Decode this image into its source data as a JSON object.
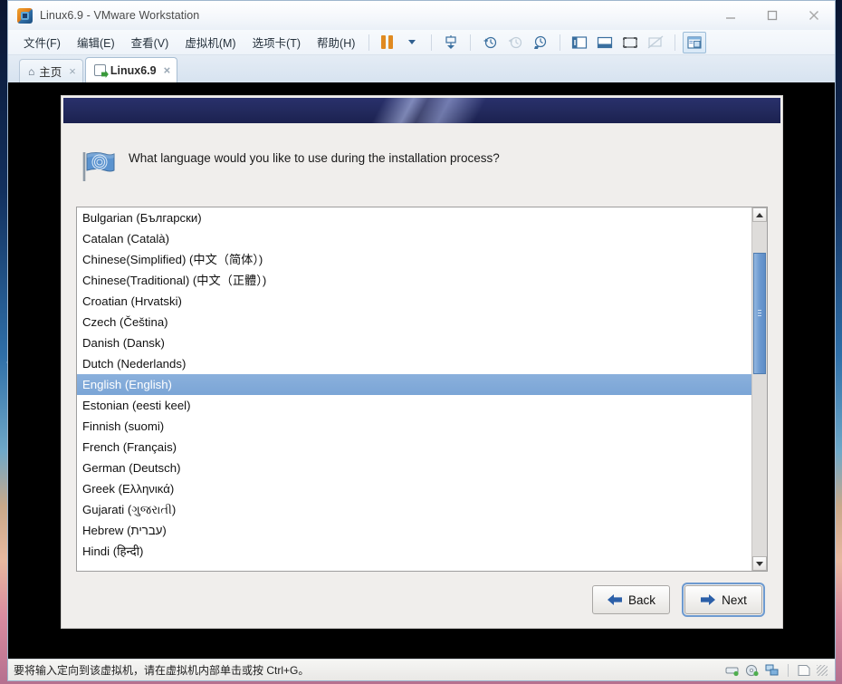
{
  "window": {
    "title": "Linux6.9 - VMware Workstation",
    "app_icon": "vmware-icon",
    "minimize_label": "Minimize",
    "maximize_label": "Maximize",
    "close_label": "Close"
  },
  "menubar": {
    "items": [
      {
        "label": "文件(F)",
        "name": "menu-file"
      },
      {
        "label": "编辑(E)",
        "name": "menu-edit"
      },
      {
        "label": "查看(V)",
        "name": "menu-view"
      },
      {
        "label": "虚拟机(M)",
        "name": "menu-vm"
      },
      {
        "label": "选项卡(T)",
        "name": "menu-tabs"
      },
      {
        "label": "帮助(H)",
        "name": "menu-help"
      }
    ],
    "toolbar_icons": [
      "suspend-icon",
      "dropdown-caret-icon",
      "power-icon",
      "snapshot-take-icon",
      "snapshot-revert-icon",
      "snapshot-manager-icon",
      "show-library-icon",
      "show-thumbnail-bar-icon",
      "fullscreen-icon",
      "unity-mode-icon",
      "console-view-icon"
    ]
  },
  "tabs": [
    {
      "label": "主页",
      "icon": "home-icon",
      "close": "×",
      "active": false
    },
    {
      "label": "Linux6.9",
      "icon": "vm-icon",
      "close": "×",
      "active": true
    }
  ],
  "installer": {
    "banner_alt": "anaconda-banner",
    "flag_icon": "language-flag-icon",
    "question": "What language would you like to use during the installation process?",
    "languages": [
      {
        "label": "Bulgarian (Български)",
        "selected": false
      },
      {
        "label": "Catalan (Català)",
        "selected": false
      },
      {
        "label": "Chinese(Simplified) (中文（简体）)",
        "selected": false
      },
      {
        "label": "Chinese(Traditional) (中文（正體）)",
        "selected": false
      },
      {
        "label": "Croatian (Hrvatski)",
        "selected": false
      },
      {
        "label": "Czech (Čeština)",
        "selected": false
      },
      {
        "label": "Danish (Dansk)",
        "selected": false
      },
      {
        "label": "Dutch (Nederlands)",
        "selected": false
      },
      {
        "label": "English (English)",
        "selected": true
      },
      {
        "label": "Estonian (eesti keel)",
        "selected": false
      },
      {
        "label": "Finnish (suomi)",
        "selected": false
      },
      {
        "label": "French (Français)",
        "selected": false
      },
      {
        "label": "German (Deutsch)",
        "selected": false
      },
      {
        "label": "Greek (Ελληνικά)",
        "selected": false
      },
      {
        "label": "Gujarati (ગુજરાતી)",
        "selected": false
      },
      {
        "label": "Hebrew (עברית)",
        "selected": false
      },
      {
        "label": "Hindi (हिन्दी)",
        "selected": false
      }
    ],
    "scrollbar": {
      "up_arrow": "scroll-up-icon",
      "down_arrow": "scroll-down-icon"
    },
    "buttons": {
      "back": "Back",
      "next": "Next"
    }
  },
  "statusbar": {
    "message": "要将输入定向到该虚拟机，请在虚拟机内部单击或按 Ctrl+G。",
    "icons": [
      "hard-disk-icon",
      "cd-dvd-icon",
      "network-adapter-icon",
      "printer-icon"
    ]
  },
  "colors": {
    "banner": "#232a5e",
    "selection": "#7ba5d6",
    "scrollbar_thumb": "#6d9ad0",
    "vm_screen": "#000000"
  }
}
